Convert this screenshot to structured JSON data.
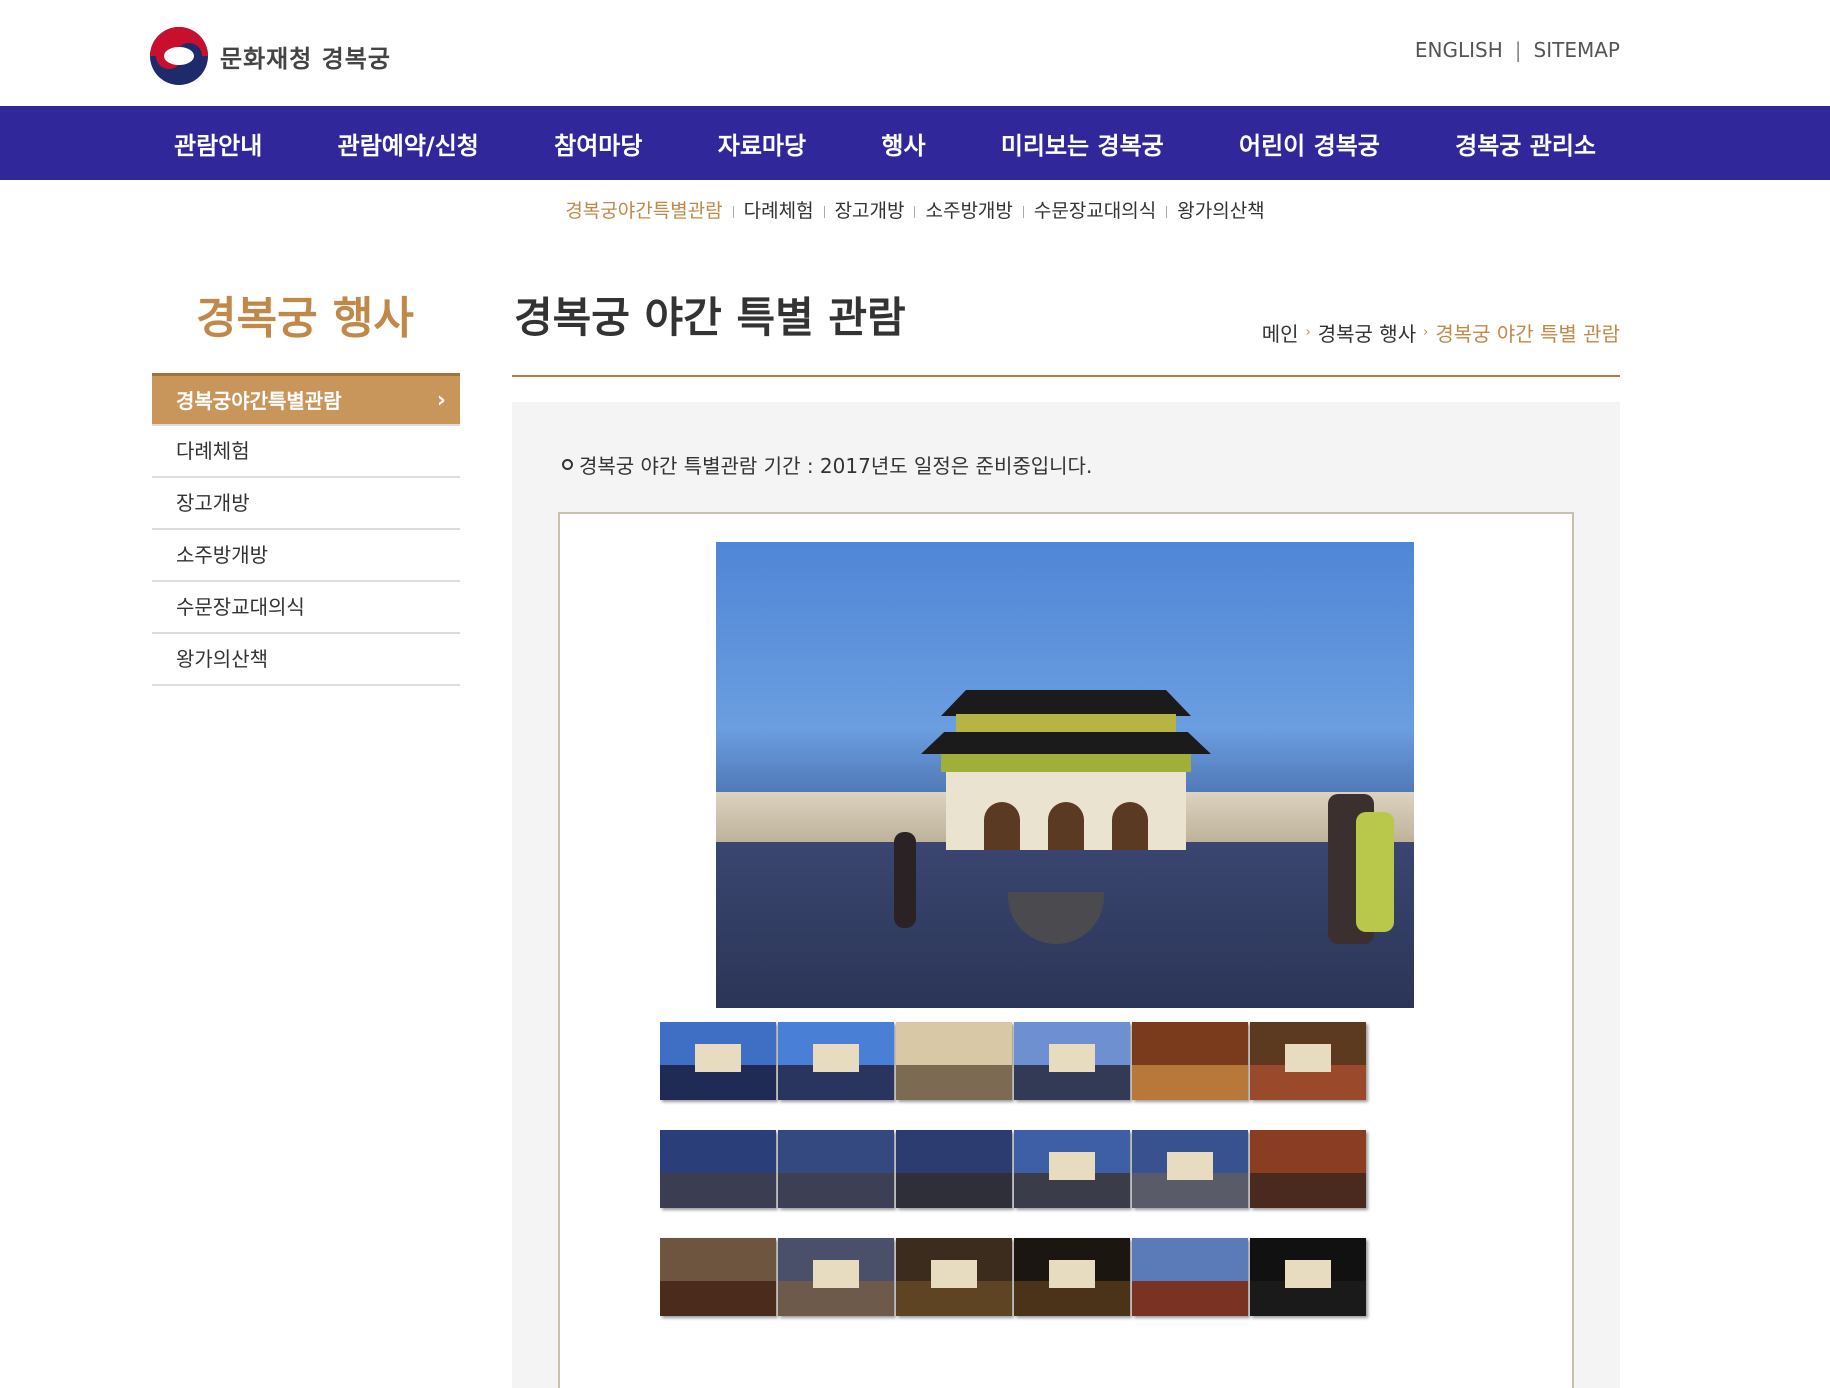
{
  "header": {
    "logo_text": "문화재청 경복궁",
    "links": [
      "ENGLISH",
      "SITEMAP"
    ],
    "link_separator": "|"
  },
  "gnb": {
    "items": [
      "관람안내",
      "관람예약/신청",
      "참여마당",
      "자료마당",
      "행사",
      "미리보는 경복궁",
      "어린이 경복궁",
      "경복궁 관리소"
    ]
  },
  "subnav": {
    "items": [
      "경복궁야간특별관람",
      "다례체험",
      "장고개방",
      "소주방개방",
      "수문장교대의식",
      "왕가의산책"
    ],
    "active_index": 0
  },
  "sidebar": {
    "title": "경복궁 행사",
    "items": [
      "경복궁야간특별관람",
      "다례체험",
      "장고개방",
      "소주방개방",
      "수문장교대의식",
      "왕가의산책"
    ],
    "active_index": 0,
    "active_arrow": "›"
  },
  "main": {
    "title": "경복궁 야간 특별 관람",
    "breadcrumb": [
      "메인",
      "경복궁 행사",
      "경복궁 야간 특별 관람"
    ],
    "breadcrumb_sep": "›",
    "notice": "경복궁 야간 특별관람 기간 : 2017년도 일정은 준비중입니다."
  },
  "colors": {
    "gnb_bg": "#30289a",
    "accent_gold": "#c0894a",
    "sidebar_active_bg": "#c8955a",
    "content_bg": "#f4f4f4"
  },
  "gallery": {
    "thumbnail_count": 18,
    "main_photo_icon": "night-palace-photo"
  }
}
